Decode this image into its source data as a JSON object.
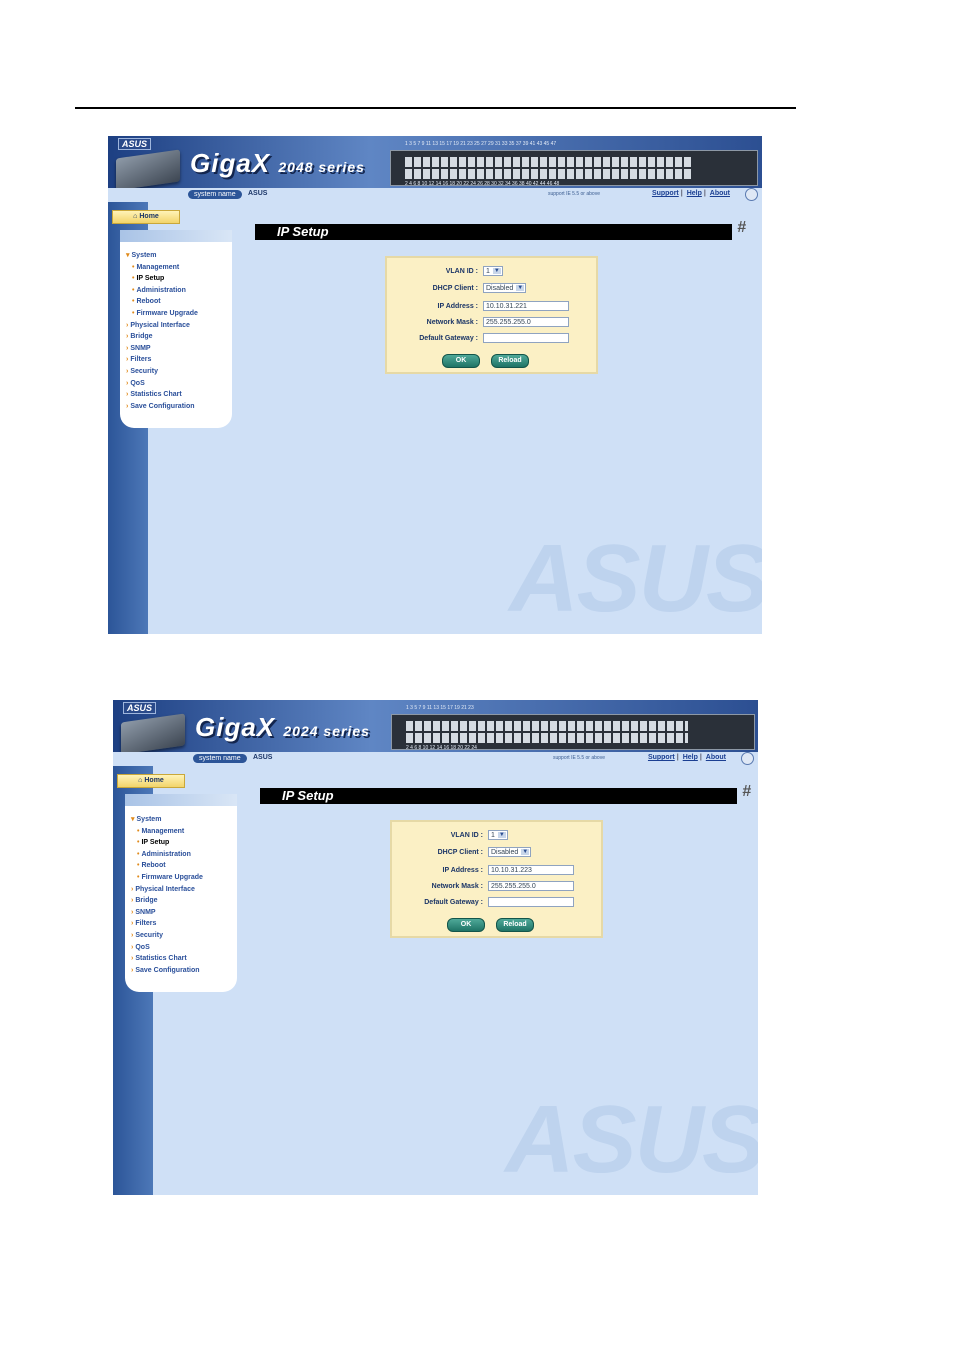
{
  "screens": [
    {
      "brand_logo": "ASUS",
      "product": {
        "name": "GigaX",
        "series": "2048 series"
      },
      "port_numbers_top": "1  3  5  7  9  11  13  15  17  19  21  23     25  27  29  31  33  35     37  39  41  43  45  47",
      "port_numbers_bottom": "2  4  6  8  10  12  14  16  18  20  22  24  26  28  30  32  34  36  38  40  42  44  46  48",
      "system_name_label": "system name",
      "system_name_value": "ASUS",
      "support_note": "support IE 5.5 or above",
      "links": {
        "support": "Support",
        "help": "Help",
        "about": "About"
      },
      "home_tab": "Home",
      "menu": [
        {
          "label": "System",
          "marker": "▾"
        },
        {
          "label": "Management",
          "marker": "•",
          "sub": true
        },
        {
          "label": "IP Setup",
          "marker": "•",
          "sub": true,
          "active": true
        },
        {
          "label": "Administration",
          "marker": "•",
          "sub": true
        },
        {
          "label": "Reboot",
          "marker": "•",
          "sub": true
        },
        {
          "label": "Firmware Upgrade",
          "marker": "•",
          "sub": true
        },
        {
          "label": "Physical Interface",
          "marker": "›"
        },
        {
          "label": "Bridge",
          "marker": "›"
        },
        {
          "label": "SNMP",
          "marker": "›"
        },
        {
          "label": "Filters",
          "marker": "›"
        },
        {
          "label": "Security",
          "marker": "›"
        },
        {
          "label": "QoS",
          "marker": "›"
        },
        {
          "label": "Statistics Chart",
          "marker": "›"
        },
        {
          "label": "Save Configuration",
          "marker": "›"
        }
      ],
      "page_title": "IP Setup",
      "form": {
        "vlan_label": "VLAN ID :",
        "vlan_value": "1",
        "dhcp_label": "DHCP Client :",
        "dhcp_value": "Disabled",
        "ip_label": "IP Address :",
        "ip_value": "10.10.31.221",
        "mask_label": "Network Mask :",
        "mask_value": "255.255.255.0",
        "gateway_label": "Default Gateway :",
        "gateway_value": "",
        "ok": "OK",
        "reload": "Reload"
      },
      "watermark": "ASUS"
    },
    {
      "brand_logo": "ASUS",
      "product": {
        "name": "GigaX",
        "series": "2024 series"
      },
      "port_numbers_top": "1  3  5  7  9  11  13  15  17  19  21  23",
      "port_numbers_bottom": "2  4  6  8  10  12  14  16  18  20  22  24",
      "system_name_label": "system name",
      "system_name_value": "ASUS",
      "support_note": "support IE 5.5 or above",
      "links": {
        "support": "Support",
        "help": "Help",
        "about": "About"
      },
      "home_tab": "Home",
      "menu": [
        {
          "label": "System",
          "marker": "▾"
        },
        {
          "label": "Management",
          "marker": "•",
          "sub": true
        },
        {
          "label": "IP Setup",
          "marker": "•",
          "sub": true,
          "active": true
        },
        {
          "label": "Administration",
          "marker": "•",
          "sub": true
        },
        {
          "label": "Reboot",
          "marker": "•",
          "sub": true
        },
        {
          "label": "Firmware Upgrade",
          "marker": "•",
          "sub": true
        },
        {
          "label": "Physical Interface",
          "marker": "›"
        },
        {
          "label": "Bridge",
          "marker": "›"
        },
        {
          "label": "SNMP",
          "marker": "›"
        },
        {
          "label": "Filters",
          "marker": "›"
        },
        {
          "label": "Security",
          "marker": "›"
        },
        {
          "label": "QoS",
          "marker": "›"
        },
        {
          "label": "Statistics Chart",
          "marker": "›"
        },
        {
          "label": "Save Configuration",
          "marker": "›"
        }
      ],
      "page_title": "IP Setup",
      "form": {
        "vlan_label": "VLAN ID :",
        "vlan_value": "1",
        "dhcp_label": "DHCP Client :",
        "dhcp_value": "Disabled",
        "ip_label": "IP Address :",
        "ip_value": "10.10.31.223",
        "mask_label": "Network Mask :",
        "mask_value": "255.255.255.0",
        "gateway_label": "Default Gateway :",
        "gateway_value": "",
        "ok": "OK",
        "reload": "Reload"
      },
      "watermark": "ASUS"
    }
  ]
}
